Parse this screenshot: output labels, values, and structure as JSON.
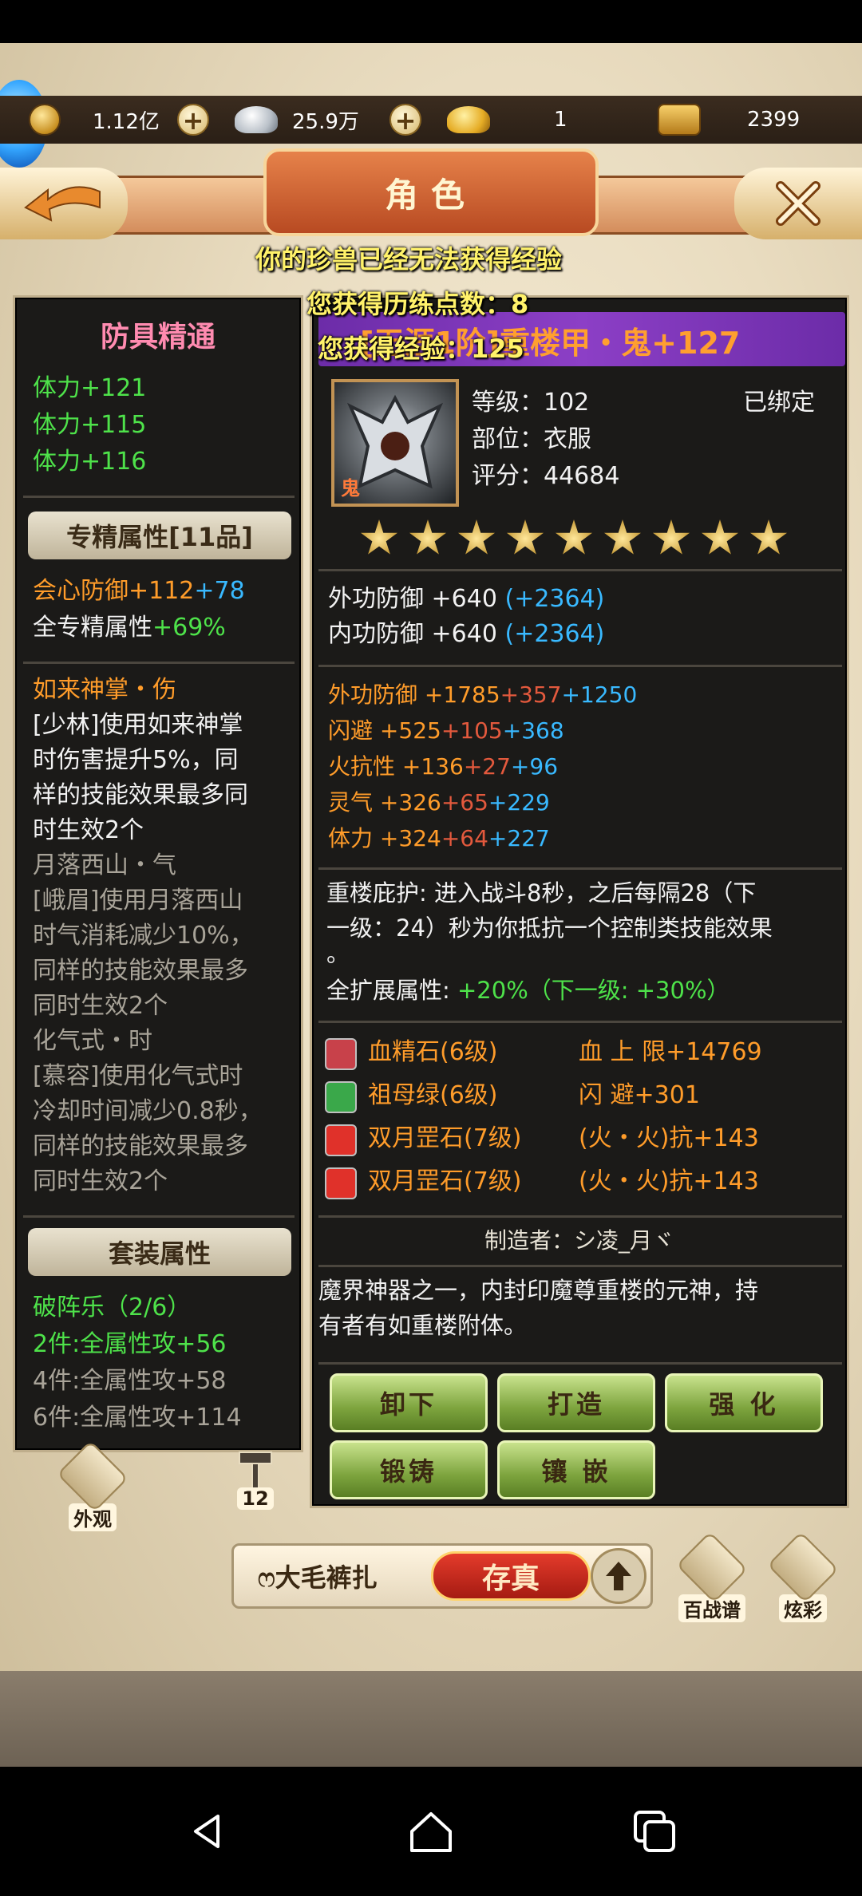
{
  "currencies": {
    "copper": "1.12亿",
    "silver": "25.9万",
    "gold": "1",
    "bound_gold": "2399"
  },
  "title": "角色",
  "toasts": {
    "pet_exp": "你的珍兽已经无法获得经验",
    "training_points": "您获得历练点数：8",
    "exp": "您获得经验：125"
  },
  "left_panel": {
    "title": "防具精通",
    "stamina_lines": [
      "体力+121",
      "体力+115",
      "体力+116"
    ],
    "spec_header": "专精属性[11品]",
    "crit_def": {
      "label": "会心防御",
      "base": "+112",
      "bonus": "+78"
    },
    "all_spec": {
      "label": "全专精属性",
      "value": "+69%"
    },
    "skill1_name": "如来神掌・伤",
    "skill1_desc": [
      "[少林]使用如来神掌",
      "时伤害提升5%，同",
      "样的技能效果最多同",
      "时生效2个"
    ],
    "skill2_name": "月落西山・气",
    "skill2_desc": [
      "[峨眉]使用月落西山",
      "时气消耗减少10%，",
      "同样的技能效果最多",
      "同时生效2个"
    ],
    "skill3_name": "化气式・时",
    "skill3_desc": [
      "[慕容]使用化气式时",
      "冷却时间减少0.8秒，",
      "同样的技能效果最多",
      "同时生效2个"
    ],
    "set_header": "套装属性",
    "set_name": "破阵乐（2/6）",
    "set_lines": [
      "2件:全属性攻+56",
      "4件:全属性攻+58",
      "6件:全属性攻+114"
    ]
  },
  "item": {
    "name": "[无涯1阶]重楼甲・鬼+127",
    "icon_tag": "鬼",
    "level_label": "等级：",
    "level": "102",
    "bound": "已绑定",
    "slot_label": "部位：",
    "slot": "衣服",
    "score_label": "评分：",
    "score": "44684",
    "stars": 9,
    "base_stats": [
      {
        "label": "外功防御 +640",
        "bonus": "(+2364)"
      },
      {
        "label": "内功防御 +640",
        "bonus": "(+2364)"
      }
    ],
    "extra_stats": [
      {
        "label": "外功防御",
        "base": "+1785",
        "red": "+357",
        "cyan": "+1250"
      },
      {
        "label": "闪避",
        "base": "+525",
        "red": "+105",
        "cyan": "+368"
      },
      {
        "label": "火抗性",
        "base": "+136",
        "red": "+27",
        "cyan": "+96"
      },
      {
        "label": "灵气",
        "base": "+326",
        "red": "+65",
        "cyan": "+229"
      },
      {
        "label": "体力",
        "base": "+324",
        "red": "+64",
        "cyan": "+227"
      }
    ],
    "passive_line1": "重楼庇护: 进入战斗8秒，之后每隔28（下",
    "passive_line2": "一级：24）秒为你抵抗一个控制类技能效果",
    "passive_line3": "。",
    "all_ext_label": "全扩展属性:",
    "all_ext_value": "+20%（下一级: +30%）",
    "gems": [
      {
        "name": "血精石(6级)",
        "effect": "血 上 限+14769",
        "color": "#c8414a"
      },
      {
        "name": "祖母绿(6级)",
        "effect": "闪 避+301",
        "color": "#3aa84a"
      },
      {
        "name": "双月罡石(7级)",
        "effect": "(火・火)抗+143",
        "color": "#e0312a"
      },
      {
        "name": "双月罡石(7级)",
        "effect": "(火・火)抗+143",
        "color": "#e0312a"
      }
    ],
    "maker": "制造者：シ凌_月ヾ",
    "desc_line1": "魔界神器之一，内封印魔尊重楼的元神，持",
    "desc_line2": "有者有如重楼附体。"
  },
  "buttons": {
    "unequip": "卸下",
    "craft": "打造",
    "enhance": "强 化",
    "forge": "锻铸",
    "inlay": "镶 嵌"
  },
  "bottom": {
    "appearance": "外观",
    "hammer_count": "12",
    "player_name": "ෆ大毛裤扎",
    "save": "存真",
    "battle_book": "百战谱",
    "dye": "炫彩"
  }
}
